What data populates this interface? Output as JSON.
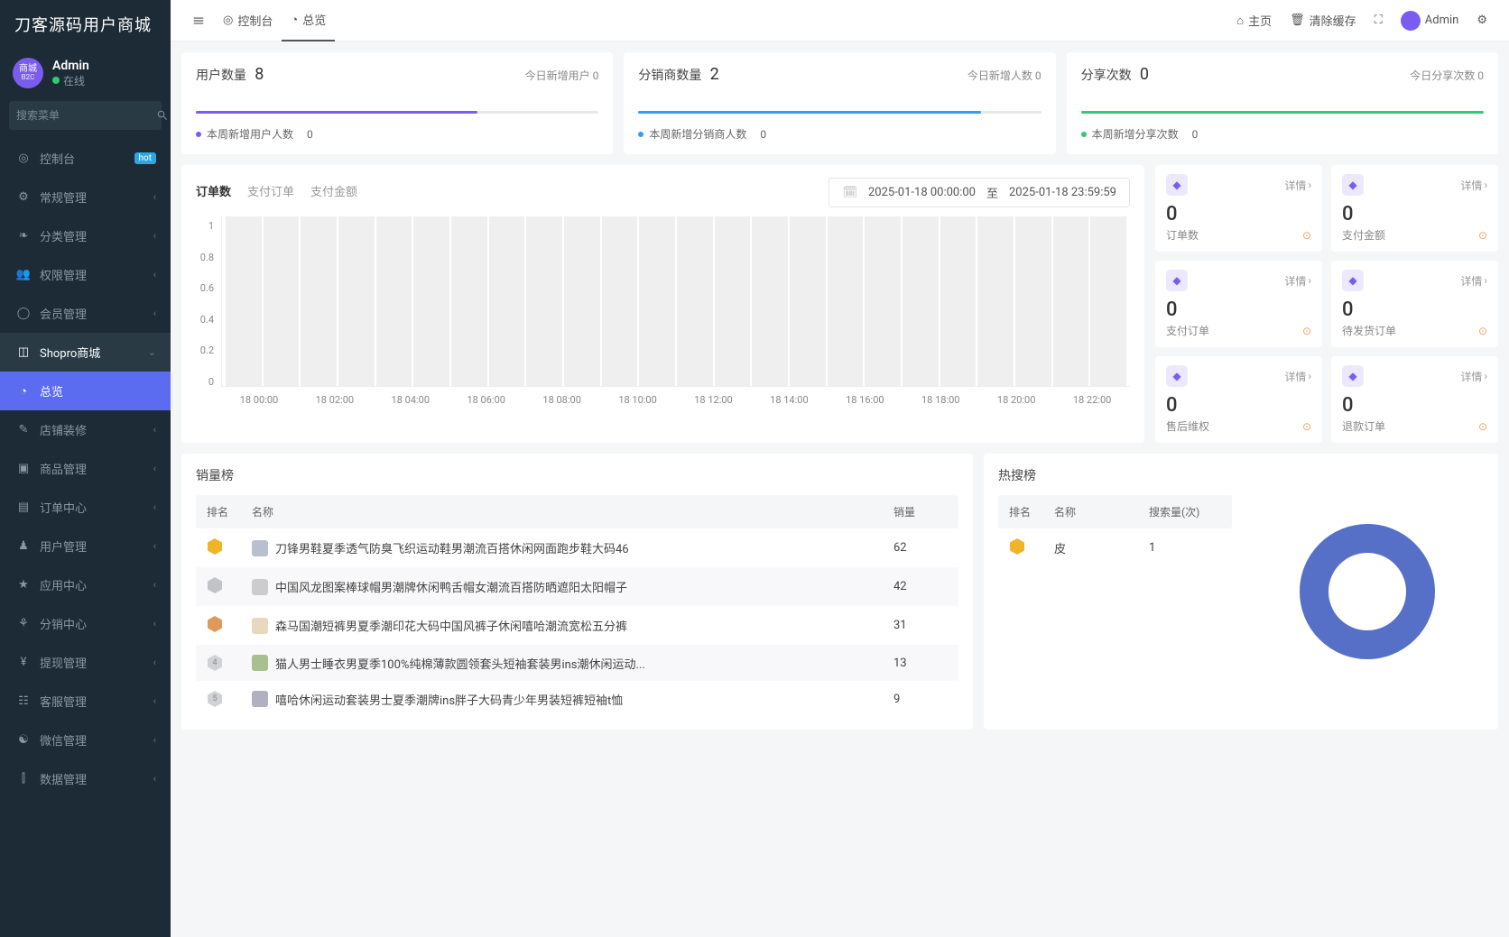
{
  "brand": "刀客源码用户商城",
  "user": {
    "name": "Admin",
    "status": "在线",
    "avatar_text": "商城",
    "avatar_sub": "B2C"
  },
  "search": {
    "placeholder": "搜索菜单"
  },
  "nav": {
    "console": "控制台",
    "hot": "hot",
    "general": "常规管理",
    "category": "分类管理",
    "permission": "权限管理",
    "member": "会员管理",
    "shopro": "Shopro商城",
    "overview": "总览",
    "decoration": "店铺装修",
    "goods": "商品管理",
    "orders": "订单中心",
    "users": "用户管理",
    "apps": "应用中心",
    "distribution": "分销中心",
    "withdraw": "提现管理",
    "service": "客服管理",
    "wechat": "微信管理",
    "data": "数据管理"
  },
  "topbar": {
    "console": "控制台",
    "overview": "总览",
    "home": "主页",
    "clear_cache": "清除缓存",
    "admin": "Admin"
  },
  "stats": {
    "users": {
      "title": "用户数量",
      "num": "8",
      "right": "今日新增用户 0",
      "foot": "本周新增用户人数",
      "foot_num": "0",
      "fill": "70%",
      "color": "#7b5cf0"
    },
    "distributors": {
      "title": "分销商数量",
      "num": "2",
      "right": "今日新增人数 0",
      "foot": "本周新增分销商人数",
      "foot_num": "0",
      "fill": "85%",
      "color": "#3a9bf0"
    },
    "shares": {
      "title": "分享次数",
      "num": "0",
      "right": "今日分享次数 0",
      "foot": "本周新增分享次数",
      "foot_num": "0",
      "fill": "100%",
      "color": "#2ecc71"
    }
  },
  "chart": {
    "tabs": {
      "orders": "订单数",
      "paid": "支付订单",
      "amount": "支付金额"
    },
    "date_from": "2025-01-18 00:00:00",
    "date_sep": "至",
    "date_to": "2025-01-18 23:59:59"
  },
  "chart_data": {
    "type": "bar",
    "title": "订单数",
    "ylim": [
      0,
      1
    ],
    "y_ticks": [
      "1",
      "0.8",
      "0.6",
      "0.4",
      "0.2",
      "0"
    ],
    "x_ticks": [
      "18 00:00",
      "18 02:00",
      "18 04:00",
      "18 06:00",
      "18 08:00",
      "18 10:00",
      "18 12:00",
      "18 14:00",
      "18 16:00",
      "18 18:00",
      "18 20:00",
      "18 22:00"
    ],
    "categories": [
      "00",
      "01",
      "02",
      "03",
      "04",
      "05",
      "06",
      "07",
      "08",
      "09",
      "10",
      "11",
      "12",
      "13",
      "14",
      "15",
      "16",
      "17",
      "18",
      "19",
      "20",
      "21",
      "22",
      "23"
    ],
    "values": [
      0,
      0,
      0,
      0,
      0,
      0,
      0,
      0,
      0,
      0,
      0,
      0,
      0,
      0,
      0,
      0,
      0,
      0,
      0,
      0,
      0,
      0,
      0,
      0
    ]
  },
  "mini": {
    "detail": "详情",
    "cards": [
      {
        "num": "0",
        "label": "订单数"
      },
      {
        "num": "0",
        "label": "支付金额"
      },
      {
        "num": "0",
        "label": "支付订单"
      },
      {
        "num": "0",
        "label": "待发货订单"
      },
      {
        "num": "0",
        "label": "售后维权"
      },
      {
        "num": "0",
        "label": "退款订单"
      }
    ]
  },
  "sales_rank": {
    "title": "销量榜",
    "col_rank": "排名",
    "col_name": "名称",
    "col_sales": "销量",
    "rows": [
      {
        "name": "刀锋男鞋夏季透气防臭飞织运动鞋男潮流百搭休闲网面跑步鞋大码46",
        "sales": "62"
      },
      {
        "name": "中国风龙图案棒球帽男潮牌休闲鸭舌帽女潮流百搭防晒遮阳太阳帽子",
        "sales": "42"
      },
      {
        "name": "森马国潮短裤男夏季潮印花大码中国风裤子休闲嘻哈潮流宽松五分裤",
        "sales": "31"
      },
      {
        "name": "猫人男士睡衣男夏季100%纯棉薄款圆领套头短袖套装男ins潮休闲运动...",
        "sales": "13"
      },
      {
        "name": "嘻哈休闲运动套装男士夏季潮牌ins胖子大码青少年男装短裤短袖t恤",
        "sales": "9"
      }
    ]
  },
  "hot_rank": {
    "title": "热搜榜",
    "col_rank": "排名",
    "col_name": "名称",
    "col_search": "搜索量(次)",
    "rows": [
      {
        "name": "皮",
        "count": "1"
      }
    ]
  }
}
